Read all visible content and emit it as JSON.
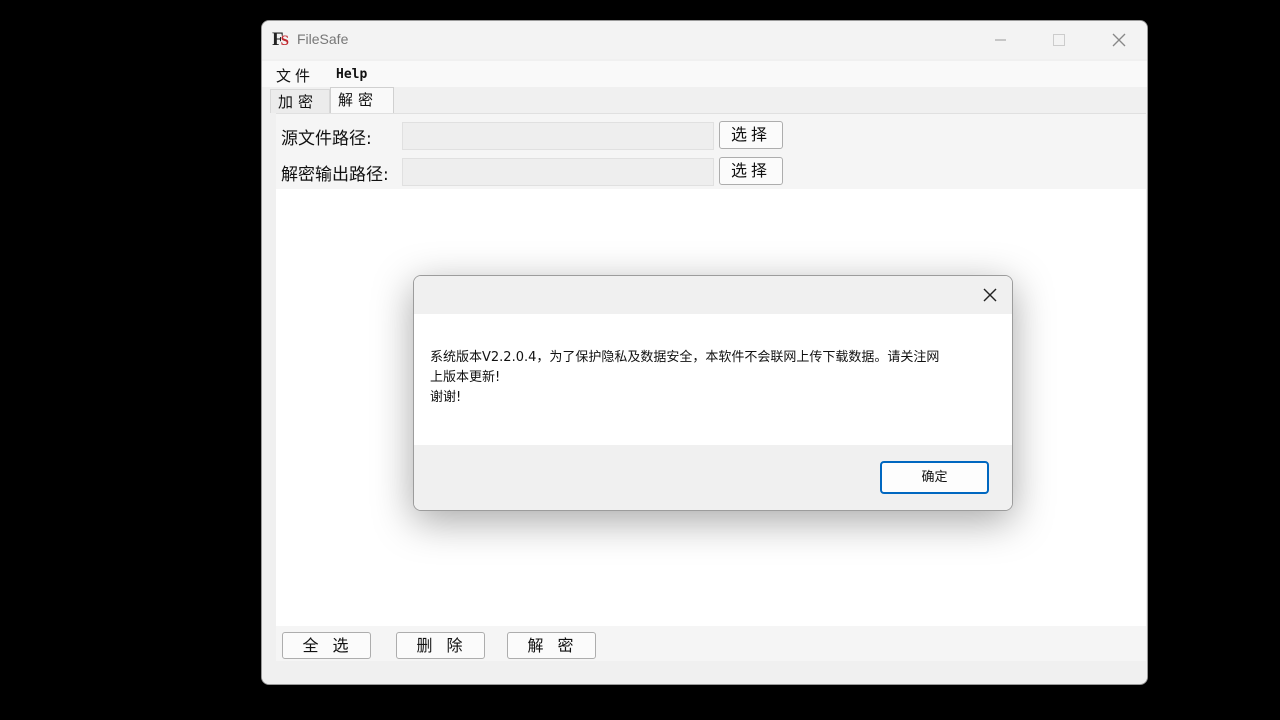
{
  "window": {
    "logo_f": "F",
    "logo_s": "S",
    "title": "FileSafe"
  },
  "menu": {
    "file": "文件",
    "help": "Help"
  },
  "tabs": [
    {
      "label": "加密",
      "active": false
    },
    {
      "label": "解密",
      "active": true
    }
  ],
  "form": {
    "source_label": "源文件路径:",
    "source_value": "",
    "output_label": "解密输出路径:",
    "output_value": "",
    "choose_label": "选择"
  },
  "actions": {
    "select_all": "全选",
    "delete": "删除",
    "decrypt": "解密"
  },
  "dialog": {
    "title": "",
    "message": "系统版本V2.2.0.4，为了保护隐私及数据安全，本软件不会联网上传下载数据。请关注网\n上版本更新!\n谢谢!",
    "ok_label": "确定"
  },
  "colors": {
    "accent": "#0067c0",
    "logo_red": "#c0262d"
  }
}
